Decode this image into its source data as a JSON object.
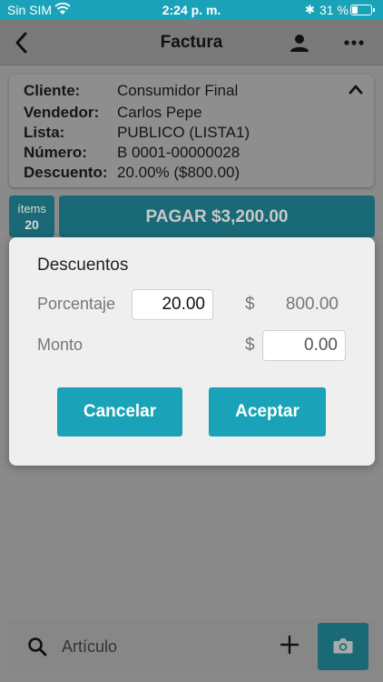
{
  "status_bar": {
    "carrier": "Sin SIM",
    "time": "2:24 p. m.",
    "battery_percent": "31 %",
    "battery_level": 0.31,
    "icons": [
      "wifi-icon",
      "bluetooth-icon",
      "battery-icon"
    ]
  },
  "nav": {
    "title": "Factura",
    "icons": [
      "back-icon",
      "person-icon",
      "more-icon"
    ]
  },
  "invoice": {
    "rows": [
      {
        "label": "Cliente:",
        "value": "Consumidor Final"
      },
      {
        "label": "Vendedor:",
        "value": "Carlos Pepe"
      },
      {
        "label": "Lista:",
        "value": "PUBLICO (LISTA1)"
      },
      {
        "label": "Número:",
        "value": "B 0001-00000028"
      },
      {
        "label": "Descuento:",
        "value": "20.00% ($800.00)"
      }
    ]
  },
  "items": {
    "label": "ítems",
    "count": "20"
  },
  "pay_button": "PAGAR $3,200.00",
  "dialog": {
    "title": "Descuentos",
    "percent_label": "Porcentaje",
    "percent_value": "20.00",
    "currency_symbol": "$",
    "percent_amount": "800.00",
    "amount_label": "Monto",
    "amount_value": "0.00",
    "cancel_label": "Cancelar",
    "accept_label": "Aceptar"
  },
  "bottom": {
    "search_placeholder": "Artículo",
    "icons": [
      "search-icon",
      "plus-icon",
      "camera-icon"
    ]
  },
  "colors": {
    "accent": "#1aa3b8",
    "overlay_bg": "#8a8a8a",
    "dialog_bg": "#efefef"
  }
}
